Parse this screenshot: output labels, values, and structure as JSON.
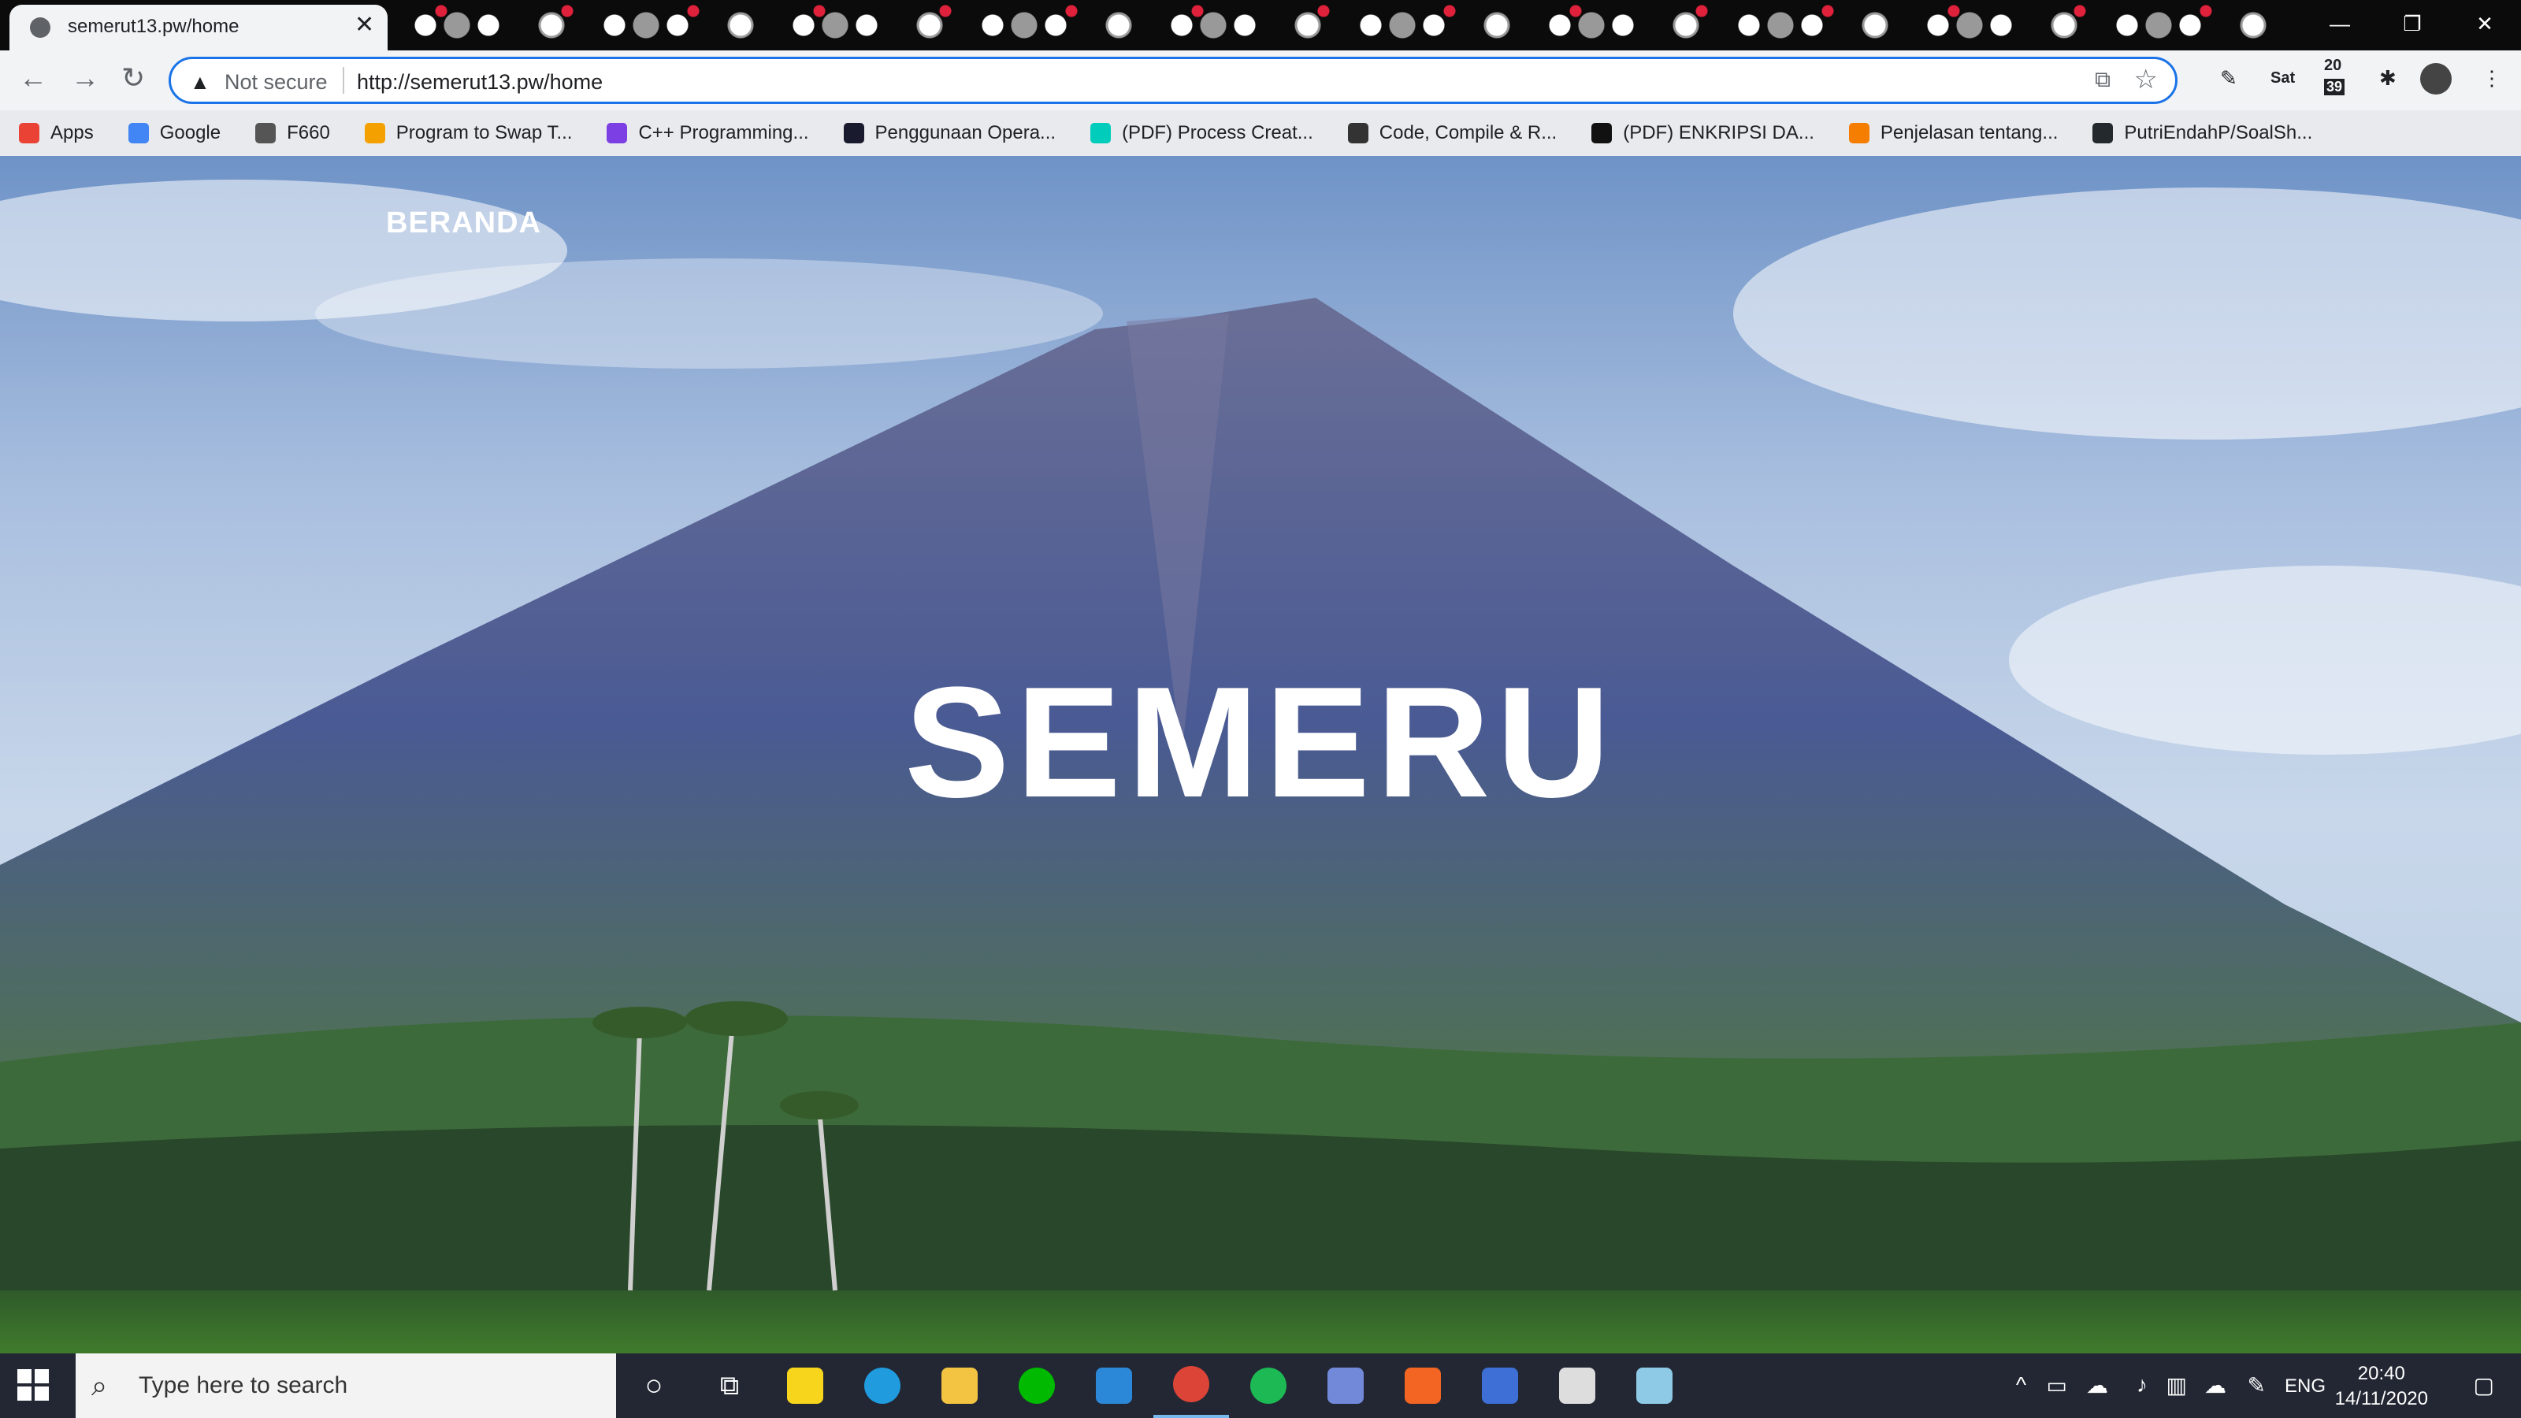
{
  "browser": {
    "tab_title": "semerut13.pw/home",
    "tab_close": "✕",
    "new_tab": "+",
    "window_controls": [
      "—",
      "❐",
      "✕"
    ],
    "security_label": "Not secure",
    "url": "http://semerut13.pw/home",
    "ext_day": "Sat",
    "ext_time_top": "20",
    "ext_time_bottom": "39"
  },
  "bookmarks": [
    {
      "label": "Apps",
      "icon": "apps-grid-icon",
      "color": "#ea4335"
    },
    {
      "label": "Google",
      "icon": "google-icon",
      "color": "#4285f4"
    },
    {
      "label": "F660",
      "icon": "globe-icon",
      "color": "#555555"
    },
    {
      "label": "Program to Swap T...",
      "icon": "site-icon",
      "color": "#f4a100"
    },
    {
      "label": "C++ Programming...",
      "icon": "site-icon",
      "color": "#7b3fe4"
    },
    {
      "label": "Penggunaan Opera...",
      "icon": "site-icon",
      "color": "#1a1a2e"
    },
    {
      "label": "(PDF) Process Creat...",
      "icon": "researchgate-icon",
      "color": "#00ccbb"
    },
    {
      "label": "Code, Compile & R...",
      "icon": "site-icon",
      "color": "#333333"
    },
    {
      "label": "(PDF) ENKRIPSI DA...",
      "icon": "academia-icon",
      "color": "#111111"
    },
    {
      "label": "Penjelasan tentang...",
      "icon": "blogger-icon",
      "color": "#f57d00"
    },
    {
      "label": "PutriEndahP/SoalSh...",
      "icon": "github-icon",
      "color": "#24292e"
    }
  ],
  "page": {
    "nav_link": "BERANDA",
    "hero_title": "SEMERU"
  },
  "taskbar": {
    "search_placeholder": "Type here to search",
    "apps": [
      {
        "name": "sticky-notes-icon",
        "color": "#f7d51d"
      },
      {
        "name": "edge-icon",
        "color": "#1f9bde"
      },
      {
        "name": "file-explorer-icon",
        "color": "#f2c442"
      },
      {
        "name": "line-icon",
        "color": "#00b900"
      },
      {
        "name": "mail-icon",
        "color": "#2b88d8"
      },
      {
        "name": "chrome-icon",
        "color": "#db4437"
      },
      {
        "name": "spotify-icon",
        "color": "#1db954"
      },
      {
        "name": "discord-icon",
        "color": "#7289da"
      },
      {
        "name": "app-icon",
        "color": "#f26522"
      },
      {
        "name": "network-app-icon",
        "color": "#3d6fd6"
      },
      {
        "name": "x-app-icon",
        "color": "#dddddd"
      },
      {
        "name": "notepad-icon",
        "color": "#8ecae6"
      }
    ],
    "lang": "ENG",
    "time": "20:40",
    "date": "14/11/2020"
  }
}
